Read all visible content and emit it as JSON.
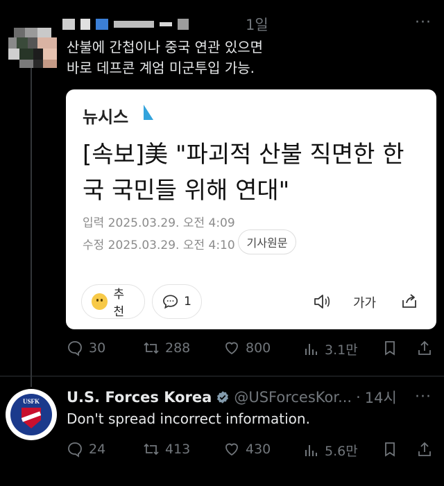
{
  "tweet1": {
    "time": "1일",
    "text_line1": "산불에 간첩이나 중국 연관 있으면",
    "text_line2": "바로 데프콘 계엄 미군투입 가능.",
    "more": "···",
    "stats": {
      "replies": "30",
      "retweets": "288",
      "likes": "800",
      "views": "3.1만"
    }
  },
  "card": {
    "brand": "뉴시스",
    "headline_line1": "[속보]美 \"파괴적 산불 직면한 한",
    "headline_line2": "국 국민들 위해 연대\"",
    "input_date": "입력 2025.03.29. 오전 4:09",
    "edit_date": "수정 2025.03.29. 오전 4:10",
    "original_button": "기사원문",
    "recommend_label": "추천",
    "comment_count": "1",
    "font_size_label": "가가"
  },
  "tweet2": {
    "name": "U.S. Forces Korea",
    "handle": "@USForcesKor...",
    "separator": "·",
    "time": "14시",
    "more": "···",
    "logo_text": "USFK",
    "text": "Don't spread incorrect information.",
    "stats": {
      "replies": "24",
      "retweets": "413",
      "likes": "430",
      "views": "5.6만"
    }
  },
  "colors": {
    "background": "#000000",
    "muted": "#71767b",
    "verified": "#829aab",
    "brand": "#33a3dc"
  }
}
